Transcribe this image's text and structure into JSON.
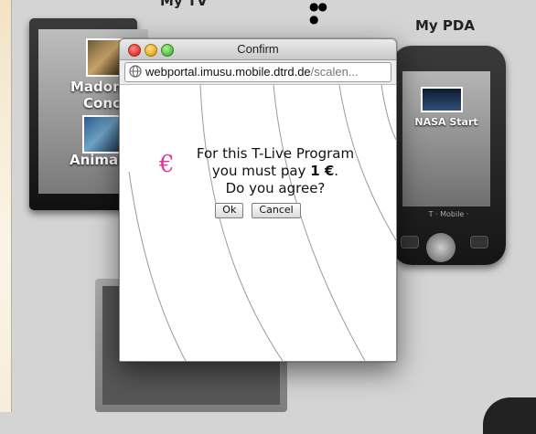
{
  "background": {
    "tv_header": "My TV",
    "pda_header": "My PDA",
    "tv_items": [
      {
        "label_line1": "Madon",
        "label_line2": "Conc"
      },
      {
        "label_line1": "Animals",
        "label_line2": ""
      }
    ],
    "pda_item": {
      "label": "NASA Start"
    },
    "pda_brand": "T · Mobile ·"
  },
  "dialog": {
    "title": "Confirm",
    "url_host": "webportal.imusu.mobile.dtrd.de",
    "url_rest": "/scalen...",
    "currency_symbol": "€",
    "message": {
      "line1": "For this T-Live Program",
      "line2_prefix": "you must pay ",
      "amount": "1 €",
      "line2_suffix": ".",
      "line3": "Do you agree?"
    },
    "buttons": {
      "ok": "Ok",
      "cancel": "Cancel"
    }
  },
  "colors": {
    "euro_accent": "#e0369a",
    "close_light": "#e0443a",
    "minimize_light": "#e8b32c",
    "zoom_light": "#5cc448"
  }
}
